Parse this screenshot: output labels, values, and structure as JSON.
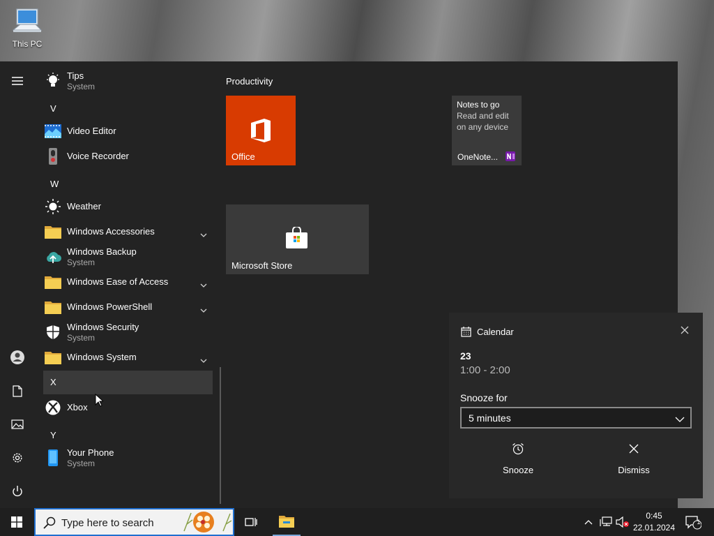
{
  "desktop": {
    "icon_label": "This PC"
  },
  "start_menu": {
    "tips": {
      "name": "Tips",
      "sub": "System"
    },
    "letters": {
      "v": "V",
      "w": "W",
      "x": "X",
      "y": "Y"
    },
    "apps": {
      "video_editor": "Video Editor",
      "voice_recorder": "Voice Recorder",
      "weather": "Weather",
      "windows_accessories": "Windows Accessories",
      "windows_backup": {
        "name": "Windows Backup",
        "sub": "System"
      },
      "windows_ease": "Windows Ease of Access",
      "windows_powershell": "Windows PowerShell",
      "windows_security": {
        "name": "Windows Security",
        "sub": "System"
      },
      "windows_system": "Windows System",
      "xbox": "Xbox",
      "your_phone": {
        "name": "Your Phone",
        "sub": "System"
      }
    },
    "tiles": {
      "group_label": "Productivity",
      "office": "Office",
      "onenote": {
        "label": "OneNote...",
        "line1": "Notes to go",
        "line2": "Read and edit",
        "line3": "on any device"
      },
      "store": "Microsoft Store"
    }
  },
  "notification": {
    "app": "Calendar",
    "title": "23",
    "time": "1:00 - 2:00",
    "snooze_label": "Snooze for",
    "snooze_value": "5 minutes",
    "snooze_button": "Snooze",
    "dismiss_button": "Dismiss"
  },
  "taskbar": {
    "search_placeholder": "Type here to search",
    "time": "0:45",
    "date": "22.01.2024",
    "notification_count": "1"
  },
  "colors": {
    "office_tile": "#d83b01",
    "tile_gray": "#3a3a3a",
    "search_border": "#1f6fd0",
    "folder": "#f2c94c"
  }
}
